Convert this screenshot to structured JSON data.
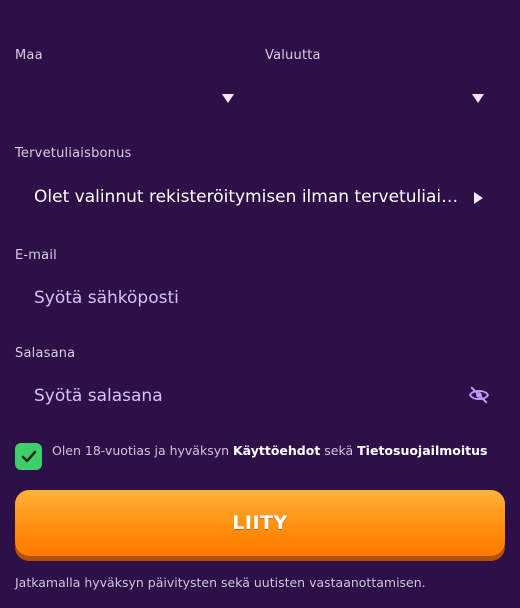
{
  "form": {
    "country": {
      "label": "Maa",
      "value": ""
    },
    "currency": {
      "label": "Valuutta",
      "value": ""
    },
    "bonus": {
      "label": "Tervetuliaisbonus",
      "value": "Olet valinnut rekisteröitymisen ilman tervetuliaisbonusta"
    },
    "email": {
      "label": "E-mail",
      "placeholder": "Syötä sähköposti"
    },
    "password": {
      "label": "Salasana",
      "placeholder": "Syötä salasana"
    },
    "terms": {
      "checked": true,
      "text_before": "Olen 18-vuotias ja hyväksyn ",
      "terms_link": "Käyttöehdot",
      "text_middle": " sekä ",
      "privacy_link": "Tietosuojailmoitus"
    },
    "submit_label": "LIITY",
    "footer_note": "Jatkamalla hyväksyn päivitysten sekä uutisten vastaanottamisen."
  },
  "icons": {
    "country_dropdown": "chevron-down-icon",
    "currency_dropdown": "chevron-down-icon",
    "bonus_arrow": "chevron-right-icon",
    "password_toggle": "eye-off-icon",
    "checkbox_mark": "checkmark-icon"
  },
  "colors": {
    "background": "#2c1047",
    "accent_orange": "#ff8f10",
    "checkbox_green": "#3fcf6a",
    "placeholder": "#d6c3f2"
  }
}
